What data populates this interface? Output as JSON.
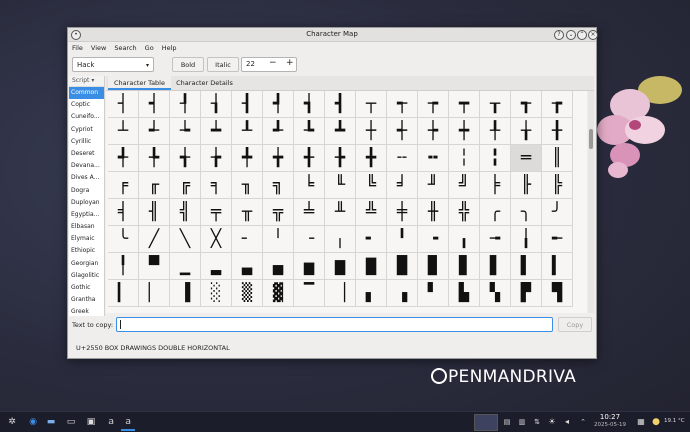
{
  "window": {
    "title": "Character Map"
  },
  "menubar": {
    "items": [
      "File",
      "View",
      "Search",
      "Go",
      "Help"
    ]
  },
  "toolbar": {
    "font": "Hack",
    "bold_label": "Bold",
    "italic_label": "Italic",
    "size": "22",
    "minus": "−",
    "plus": "+"
  },
  "scripts": {
    "header": "Script",
    "items": [
      "Common",
      "Coptic",
      "Cuneifo...",
      "Cypriot",
      "Cyrillic",
      "Deseret",
      "Devana...",
      "Dives A...",
      "Dogra",
      "Duployan",
      "Egyptia...",
      "Elbasan",
      "Elymaic",
      "Ethiopic",
      "Georgian",
      "Glagolitic",
      "Gothic",
      "Grantha",
      "Greek"
    ],
    "selected": "Common"
  },
  "tabs": [
    {
      "label": "Character Table",
      "active": true
    },
    {
      "label": "Character Details",
      "active": false
    }
  ],
  "glyphs": [
    [
      "┤",
      "┥",
      "┦",
      "┧",
      "┨",
      "┩",
      "┪",
      "┫",
      "┬",
      "┭",
      "┮",
      "┯",
      "┰",
      "┱",
      "┲"
    ],
    [
      "┴",
      "┵",
      "┶",
      "┷",
      "┸",
      "┹",
      "┺",
      "┻",
      "┼",
      "┽",
      "┾",
      "┿",
      "╀",
      "╁",
      "╂"
    ],
    [
      "╃",
      "╄",
      "╅",
      "╆",
      "╇",
      "╈",
      "╉",
      "╊",
      "╋",
      "╌",
      "╍",
      "╎",
      "╏",
      "═",
      "║"
    ],
    [
      "╒",
      "╓",
      "╔",
      "╕",
      "╖",
      "╗",
      "╘",
      "╙",
      "╚",
      "╛",
      "╜",
      "╝",
      "╞",
      "╟",
      "╠"
    ],
    [
      "╡",
      "╢",
      "╣",
      "╤",
      "╥",
      "╦",
      "╧",
      "╨",
      "╩",
      "╪",
      "╫",
      "╬",
      "╭",
      "╮",
      "╯"
    ],
    [
      "╰",
      "╱",
      "╲",
      "╳",
      "╴",
      "╵",
      "╶",
      "╷",
      "╸",
      "╹",
      "╺",
      "╻",
      "╼",
      "╽",
      "╾"
    ],
    [
      "╿",
      "▀",
      "▁",
      "▂",
      "▃",
      "▄",
      "▅",
      "▆",
      "▇",
      "█",
      "▉",
      "▊",
      "▋",
      "▌",
      "▍"
    ],
    [
      "▎",
      "▏",
      "▐",
      "░",
      "▒",
      "▓",
      "▔",
      "▕",
      "▖",
      "▗",
      "▘",
      "▙",
      "▚",
      "▛",
      "▜"
    ]
  ],
  "selected_glyph": "═",
  "copy": {
    "label": "Text to copy:",
    "value": "",
    "button": "Copy"
  },
  "status": "U+2550 BOX DRAWINGS DOUBLE HORIZONTAL",
  "desktop": {
    "logo": "PENMANDRIVA"
  },
  "taskbar": {
    "time": "10:27",
    "date": "2025-05-19",
    "temp": "19.1 °C"
  },
  "colors": {
    "accent": "#3b8ee5",
    "desktop": "#2a2c3e"
  }
}
